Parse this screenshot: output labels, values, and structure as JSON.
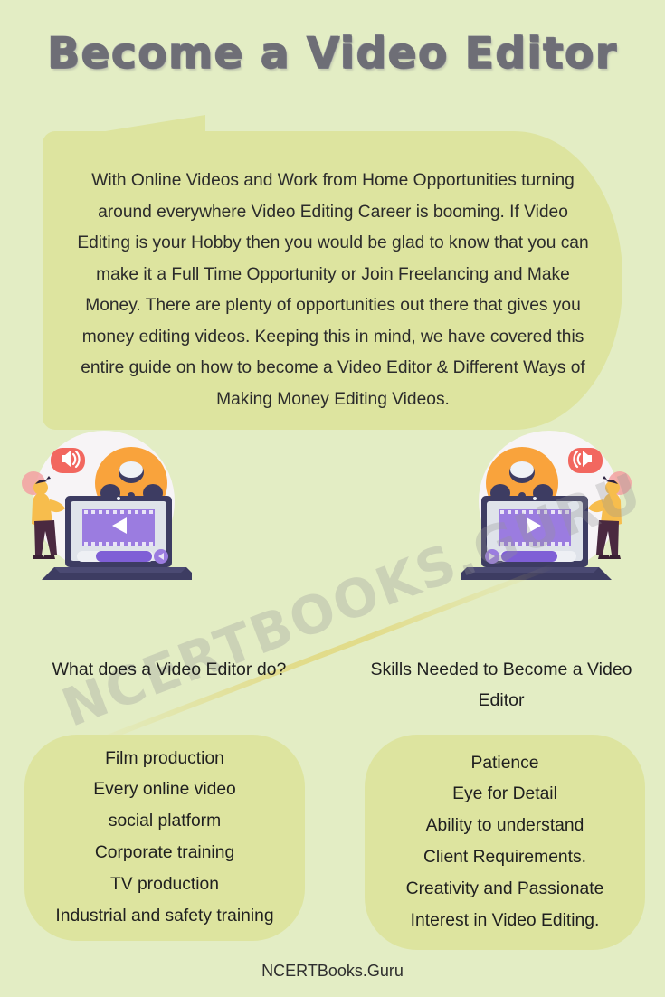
{
  "page": {
    "background_color": "#e3edc4",
    "panel_color": "#dde49f"
  },
  "title": "Become a Video Editor",
  "intro": {
    "paragraph": "With Online Videos and Work from Home Opportunities turning around everywhere Video Editing Career is booming. If Video Editing is your Hobby then you would be glad to know that you can make it a Full Time Opportunity or Join Freelancing and Make Money. There are plenty of opportunities out there that gives you money editing videos. Keeping this in mind, we have covered this entire guide on how to become a Video Editor & Different Ways of Making Money Editing Videos."
  },
  "watermark": {
    "text": "NCERTBOOKS.GURU"
  },
  "illustrations": [
    {
      "name": "video-editing-left",
      "description": "Person at laptop with film reel and speaker",
      "colors": {
        "reel": "#f7a93b",
        "speaker_badge": "#f2675f",
        "screen": "#9b7ce0",
        "laptop": "#3d3c62",
        "sweater": "#f7bd4d",
        "trousers": "#4a2940"
      }
    },
    {
      "name": "video-editing-right",
      "description": "Mirrored person at laptop with film reel and speaker",
      "colors": {
        "reel": "#f7a93b",
        "speaker_badge": "#f2675f",
        "screen": "#9b7ce0",
        "laptop": "#3d3c62",
        "sweater": "#f7bd4d",
        "trousers": "#4a2940"
      }
    }
  ],
  "sections": [
    {
      "heading": "What does a Video Editor do?",
      "items": [
        "Film production",
        "Every online video",
        "social platform",
        "Corporate training",
        "TV production",
        "Industrial and safety training"
      ]
    },
    {
      "heading": "Skills Needed to Become a Video Editor",
      "items": [
        "Patience",
        "Eye for Detail",
        "Ability to understand",
        "Client Requirements.",
        "Creativity and Passionate",
        "Interest in Video Editing."
      ]
    }
  ],
  "footer": {
    "brand": "NCERTBooks.Guru"
  }
}
